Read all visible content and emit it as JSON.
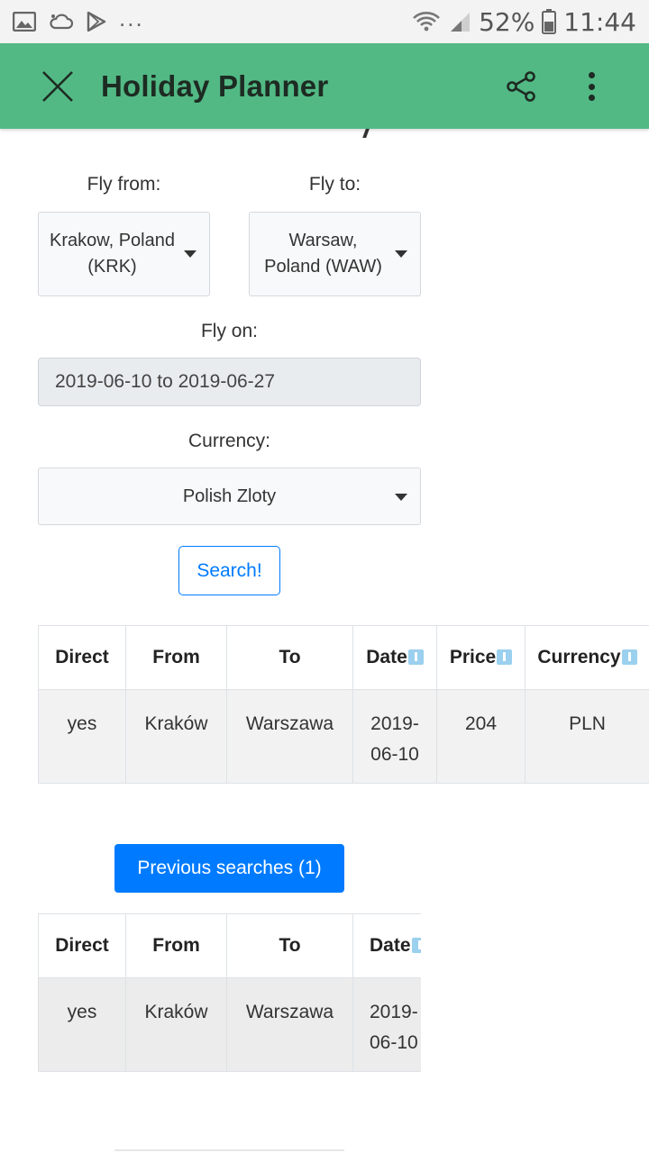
{
  "status_bar": {
    "battery": "52%",
    "time": "11:44",
    "overflow": "..."
  },
  "app_bar": {
    "title": "Holiday Planner"
  },
  "form": {
    "fly_from_label": "Fly from:",
    "fly_from_value": [
      "Krakow, Poland",
      "(KRK)"
    ],
    "fly_to_label": "Fly to:",
    "fly_to_value": [
      "Warsaw,",
      "Poland (WAW)"
    ],
    "fly_on_label": "Fly on:",
    "fly_on_value": "2019-06-10 to 2019-06-27",
    "currency_label": "Currency:",
    "currency_value": "Polish Zloty",
    "search_button": "Search!"
  },
  "results_table": {
    "columns": [
      "Direct",
      "From",
      "To",
      "Date",
      "Price",
      "Currency"
    ],
    "rows": [
      [
        "yes",
        "Kraków",
        "Warszawa",
        "2019-06-10",
        "204",
        "PLN"
      ]
    ],
    "date_display": [
      "2019-",
      "06-10"
    ]
  },
  "previous_searches": {
    "button_label": "Previous searches (1)",
    "columns": [
      "Direct",
      "From",
      "To",
      "Date"
    ],
    "rows": [
      [
        "yes",
        "Kraków",
        "Warszawa",
        "2019-06-10"
      ]
    ],
    "date_display": [
      "2019-",
      "06-10"
    ]
  },
  "colors": {
    "app_bar": "#52b985",
    "primary": "#007bff",
    "sort_icon": "#9bd0ee"
  }
}
